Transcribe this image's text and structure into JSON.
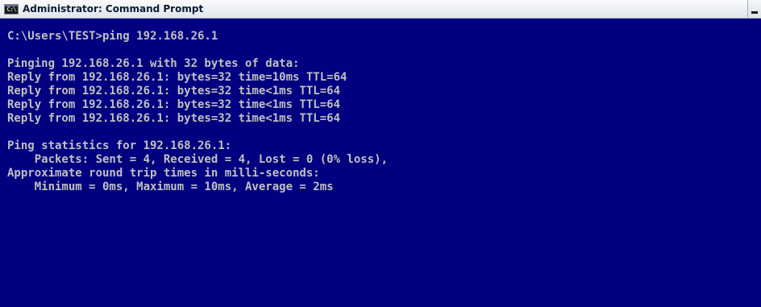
{
  "window": {
    "title": "Administrator: Command Prompt",
    "icon_text": "C:\\",
    "icon": "console-icon"
  },
  "colors": {
    "console_background": "#000080",
    "console_text": "#c0c0c0"
  },
  "console": {
    "command_line": "C:\\Users\\TEST>ping 192.168.26.1",
    "pinging_line": "Pinging 192.168.26.1 with 32 bytes of data:",
    "replies": [
      "Reply from 192.168.26.1: bytes=32 time=10ms TTL=64",
      "Reply from 192.168.26.1: bytes=32 time<1ms TTL=64",
      "Reply from 192.168.26.1: bytes=32 time<1ms TTL=64",
      "Reply from 192.168.26.1: bytes=32 time<1ms TTL=64"
    ],
    "stats_header": "Ping statistics for 192.168.26.1:",
    "packets_line": "    Packets: Sent = 4, Received = 4, Lost = 0 (0% loss),",
    "rtt_header": "Approximate round trip times in milli-seconds:",
    "rtt_line": "    Minimum = 0ms, Maximum = 10ms, Average = 2ms"
  }
}
